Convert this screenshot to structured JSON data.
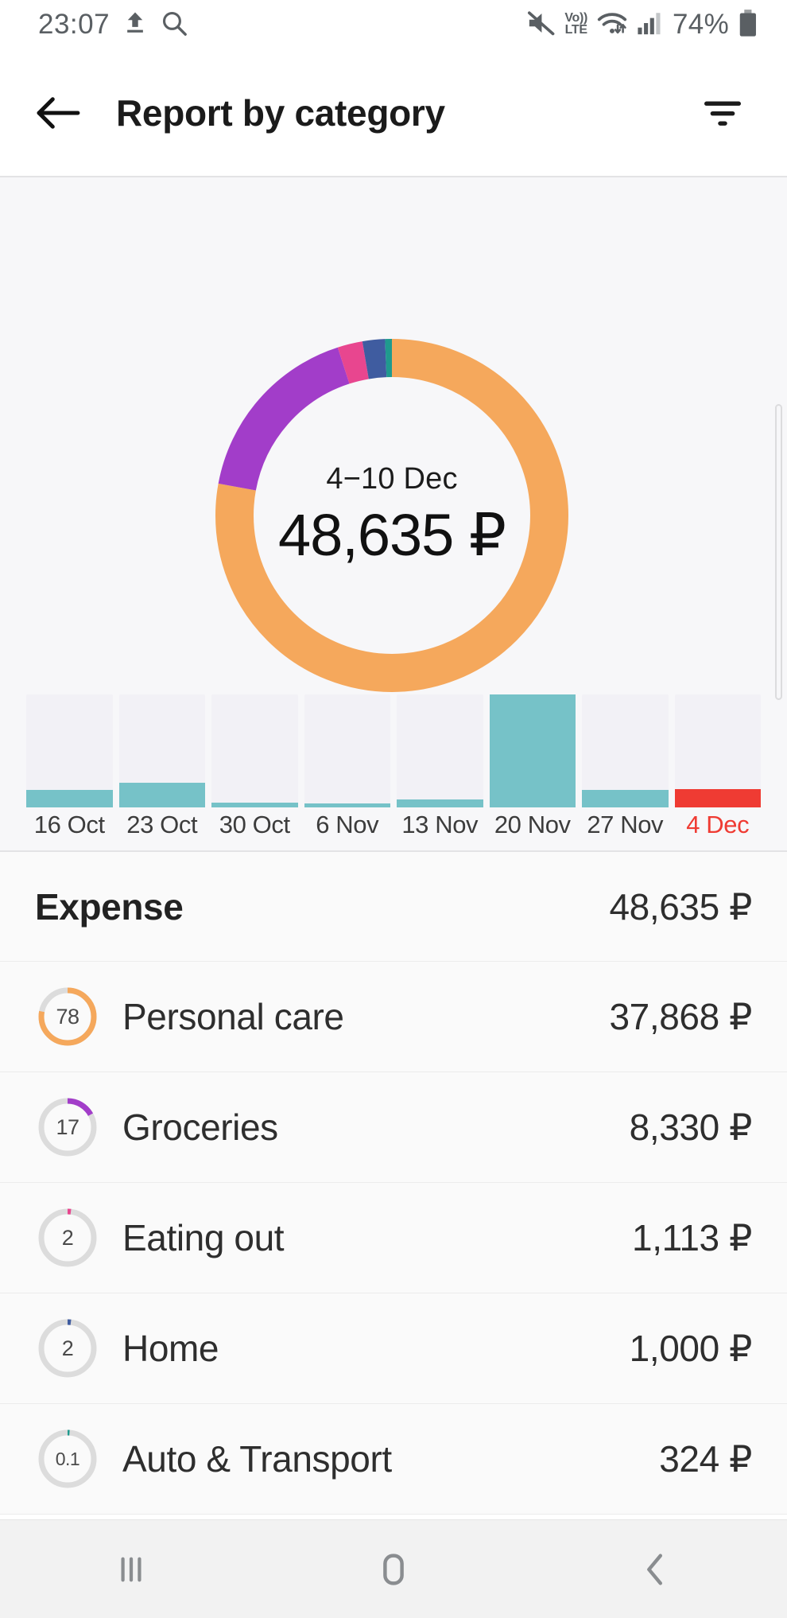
{
  "statusbar": {
    "time": "23:07",
    "battery_pct": "74%",
    "volte_top": "Vo))",
    "volte_bottom": "LTE",
    "icons": [
      "upload-icon",
      "search-icon",
      "mute-icon",
      "volte-icon",
      "wifi-icon",
      "signal-icon",
      "battery-icon"
    ]
  },
  "appbar": {
    "title": "Report by category",
    "back_label": "Back",
    "filter_label": "Filter"
  },
  "donut": {
    "period": "4−10 Dec",
    "total": "48,635 ₽"
  },
  "list": {
    "header": {
      "label": "Expense",
      "amount": "48,635 ₽"
    },
    "rows": [
      {
        "pct": "78",
        "label": "Personal care",
        "amount": "37,868 ₽",
        "color": "#f5a85c"
      },
      {
        "pct": "17",
        "label": "Groceries",
        "amount": "8,330 ₽",
        "color": "#a23dc9"
      },
      {
        "pct": "2",
        "label": "Eating out",
        "amount": "1,113 ₽",
        "color": "#e8468f"
      },
      {
        "pct": "2",
        "label": "Home",
        "amount": "1,000 ₽",
        "color": "#3f5ca0"
      },
      {
        "pct": "0.1",
        "label": "Auto & Transport",
        "amount": "324 ₽",
        "color": "#1f9a8e"
      }
    ]
  },
  "navbar": {
    "recents_label": "Recents",
    "home_label": "Home",
    "back_label": "Back"
  },
  "colors": {
    "orange": "#f5a85c",
    "purple": "#a23dc9",
    "pink": "#e8468f",
    "blue": "#3f5ca0",
    "teal": "#1f9a8e",
    "bar_fill": "#76c2c8",
    "bar_track": "#f2f1f6",
    "bar_negative": "#ef3b33",
    "panel_bg": "#f7f7f9"
  },
  "chart_data": [
    {
      "type": "pie",
      "title": "4−10 Dec",
      "subtitle": "48,635 ₽",
      "center_label": "48,635 ₽",
      "unit": "₽",
      "total": 48635,
      "categories": [
        "Personal care",
        "Groceries",
        "Eating out",
        "Home",
        "Auto & Transport"
      ],
      "values": [
        37868,
        8330,
        1113,
        1000,
        324
      ],
      "percentages": [
        78,
        17,
        2,
        2,
        0.1
      ],
      "colors": [
        "#f5a85c",
        "#a23dc9",
        "#e8468f",
        "#3f5ca0",
        "#1f9a8e"
      ],
      "donut": true,
      "legend": "none",
      "start_angle": 0,
      "direction": "clockwise"
    },
    {
      "type": "bar",
      "title": "",
      "xlabel": "",
      "ylabel": "",
      "categories": [
        "16 Oct",
        "23 Oct",
        "30 Oct",
        "6 Nov",
        "13 Nov",
        "20 Nov",
        "27 Nov",
        "4 Dec"
      ],
      "values": [
        22,
        30,
        6,
        5,
        10,
        139,
        22,
        23
      ],
      "value_unit": "relative height (px of 139 max track)",
      "selected_index": 7,
      "selected_label": "4 Dec",
      "series_color": "#76c2c8",
      "selected_color": "#ef3b33",
      "track_color": "#f2f1f6",
      "grid": false,
      "ylim": [
        0,
        139
      ]
    }
  ]
}
